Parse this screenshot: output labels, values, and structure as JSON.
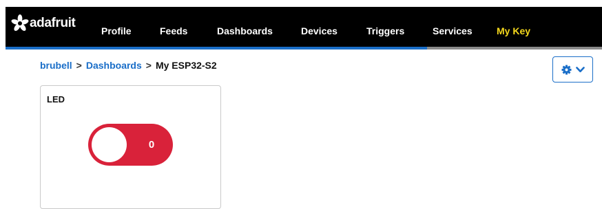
{
  "header": {
    "logo_text": "adafruit",
    "nav": [
      {
        "label": "Profile"
      },
      {
        "label": "Feeds"
      },
      {
        "label": "Dashboards"
      },
      {
        "label": "Devices"
      },
      {
        "label": "Triggers"
      },
      {
        "label": "Services"
      },
      {
        "label": "My Key"
      }
    ],
    "accent_color": "#1a6ec8",
    "highlight_color": "#f5d81c"
  },
  "breadcrumb": {
    "items": [
      "brubell",
      "Dashboards"
    ],
    "separator": ">",
    "current": "My ESP32-S2"
  },
  "settings_button": {
    "icons": [
      "gear-icon",
      "chevron-down-icon"
    ]
  },
  "block": {
    "title": "LED",
    "toggle": {
      "value": "0",
      "state": "off",
      "color": "#d9223a"
    }
  }
}
